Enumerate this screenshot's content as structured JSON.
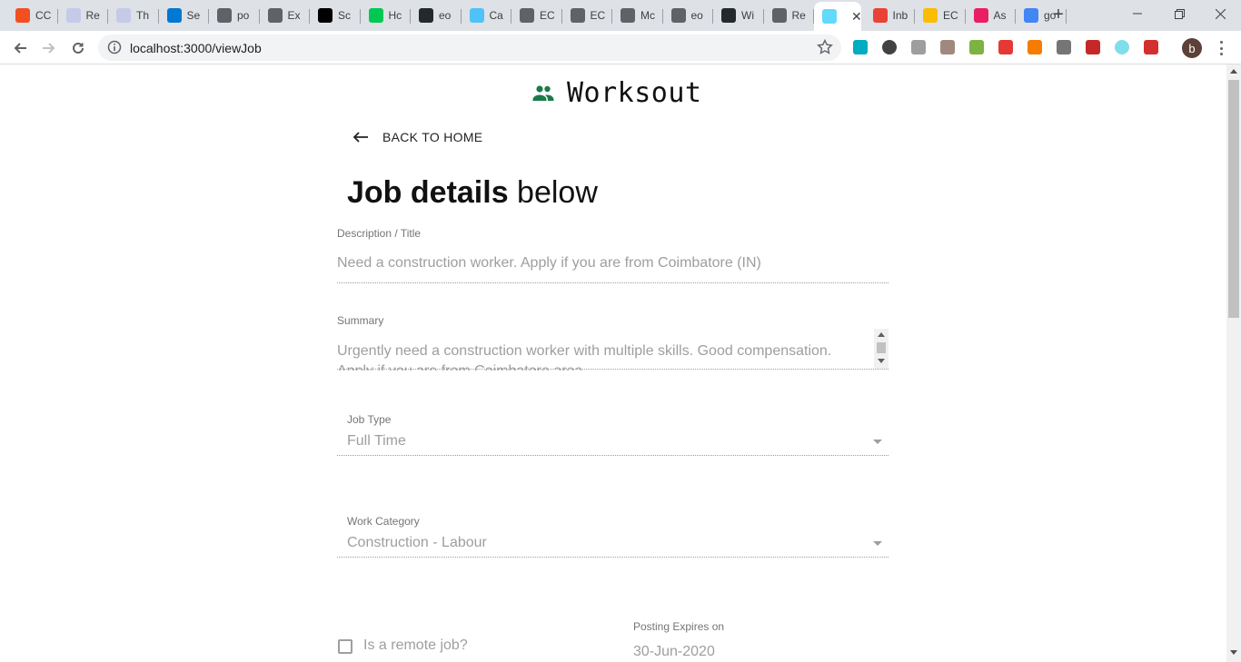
{
  "browser": {
    "tabs": [
      {
        "label": "CC",
        "favicon": "windows-logo-icon",
        "color": "#f25022"
      },
      {
        "label": "Re",
        "favicon": "document-icon",
        "color": "#c5cae9"
      },
      {
        "label": "Th",
        "favicon": "document-icon",
        "color": "#c5cae9"
      },
      {
        "label": "Se",
        "favicon": "azure-icon",
        "color": "#0078d4"
      },
      {
        "label": "po",
        "favicon": "globe-icon",
        "color": "#5f6368"
      },
      {
        "label": "Ex",
        "favicon": "leaf-icon",
        "color": "#5f6368"
      },
      {
        "label": "Sc",
        "favicon": "medium-icon",
        "color": "#000000"
      },
      {
        "label": "Hc",
        "favicon": "power-icon",
        "color": "#00c853"
      },
      {
        "label": "eo",
        "favicon": "github-icon",
        "color": "#24292e"
      },
      {
        "label": "Ca",
        "favicon": "eos-icon",
        "color": "#4fc3f7"
      },
      {
        "label": "EC",
        "favicon": "leaf-icon",
        "color": "#5f6368"
      },
      {
        "label": "EC",
        "favicon": "leaf-icon",
        "color": "#5f6368"
      },
      {
        "label": "Mc",
        "favicon": "diamond-icon",
        "color": "#5f6368"
      },
      {
        "label": "eo",
        "favicon": "globe-icon",
        "color": "#5f6368"
      },
      {
        "label": "Wi",
        "favicon": "github-icon",
        "color": "#24292e"
      },
      {
        "label": "Re",
        "favicon": "leaf-icon",
        "color": "#5f6368"
      },
      {
        "label": "",
        "favicon": "react-icon",
        "color": "#61dafb",
        "active": true
      },
      {
        "label": "Inb",
        "favicon": "gmail-icon",
        "color": "#ea4335"
      },
      {
        "label": "EC",
        "favicon": "slides-icon",
        "color": "#fbbc04"
      },
      {
        "label": "As",
        "favicon": "asana-icon",
        "color": "#e91e63"
      },
      {
        "label": "go",
        "favicon": "google-icon",
        "color": "#4285f4"
      }
    ],
    "url": "localhost:3000/viewJob"
  },
  "app": {
    "brand": "Worksout",
    "brand_color": "#1b7a4a",
    "back_label": "BACK TO HOME",
    "heading_bold": "Job details",
    "heading_rest": " below"
  },
  "form": {
    "title_label": "Description / Title",
    "title_value": "Need a construction worker. Apply if you are from Coimbatore (IN)",
    "summary_label": "Summary",
    "summary_value": "Urgently need a construction worker with multiple skills. Good compensation. Apply if you are from Coimbatore area.",
    "job_type_label": "Job Type",
    "job_type_value": "Full Time",
    "category_label": "Work Category",
    "category_value": "Construction - Labour",
    "remote_label": "Is a remote job?",
    "expires_label": "Posting Expires on",
    "expires_value": "30-Jun-2020"
  }
}
